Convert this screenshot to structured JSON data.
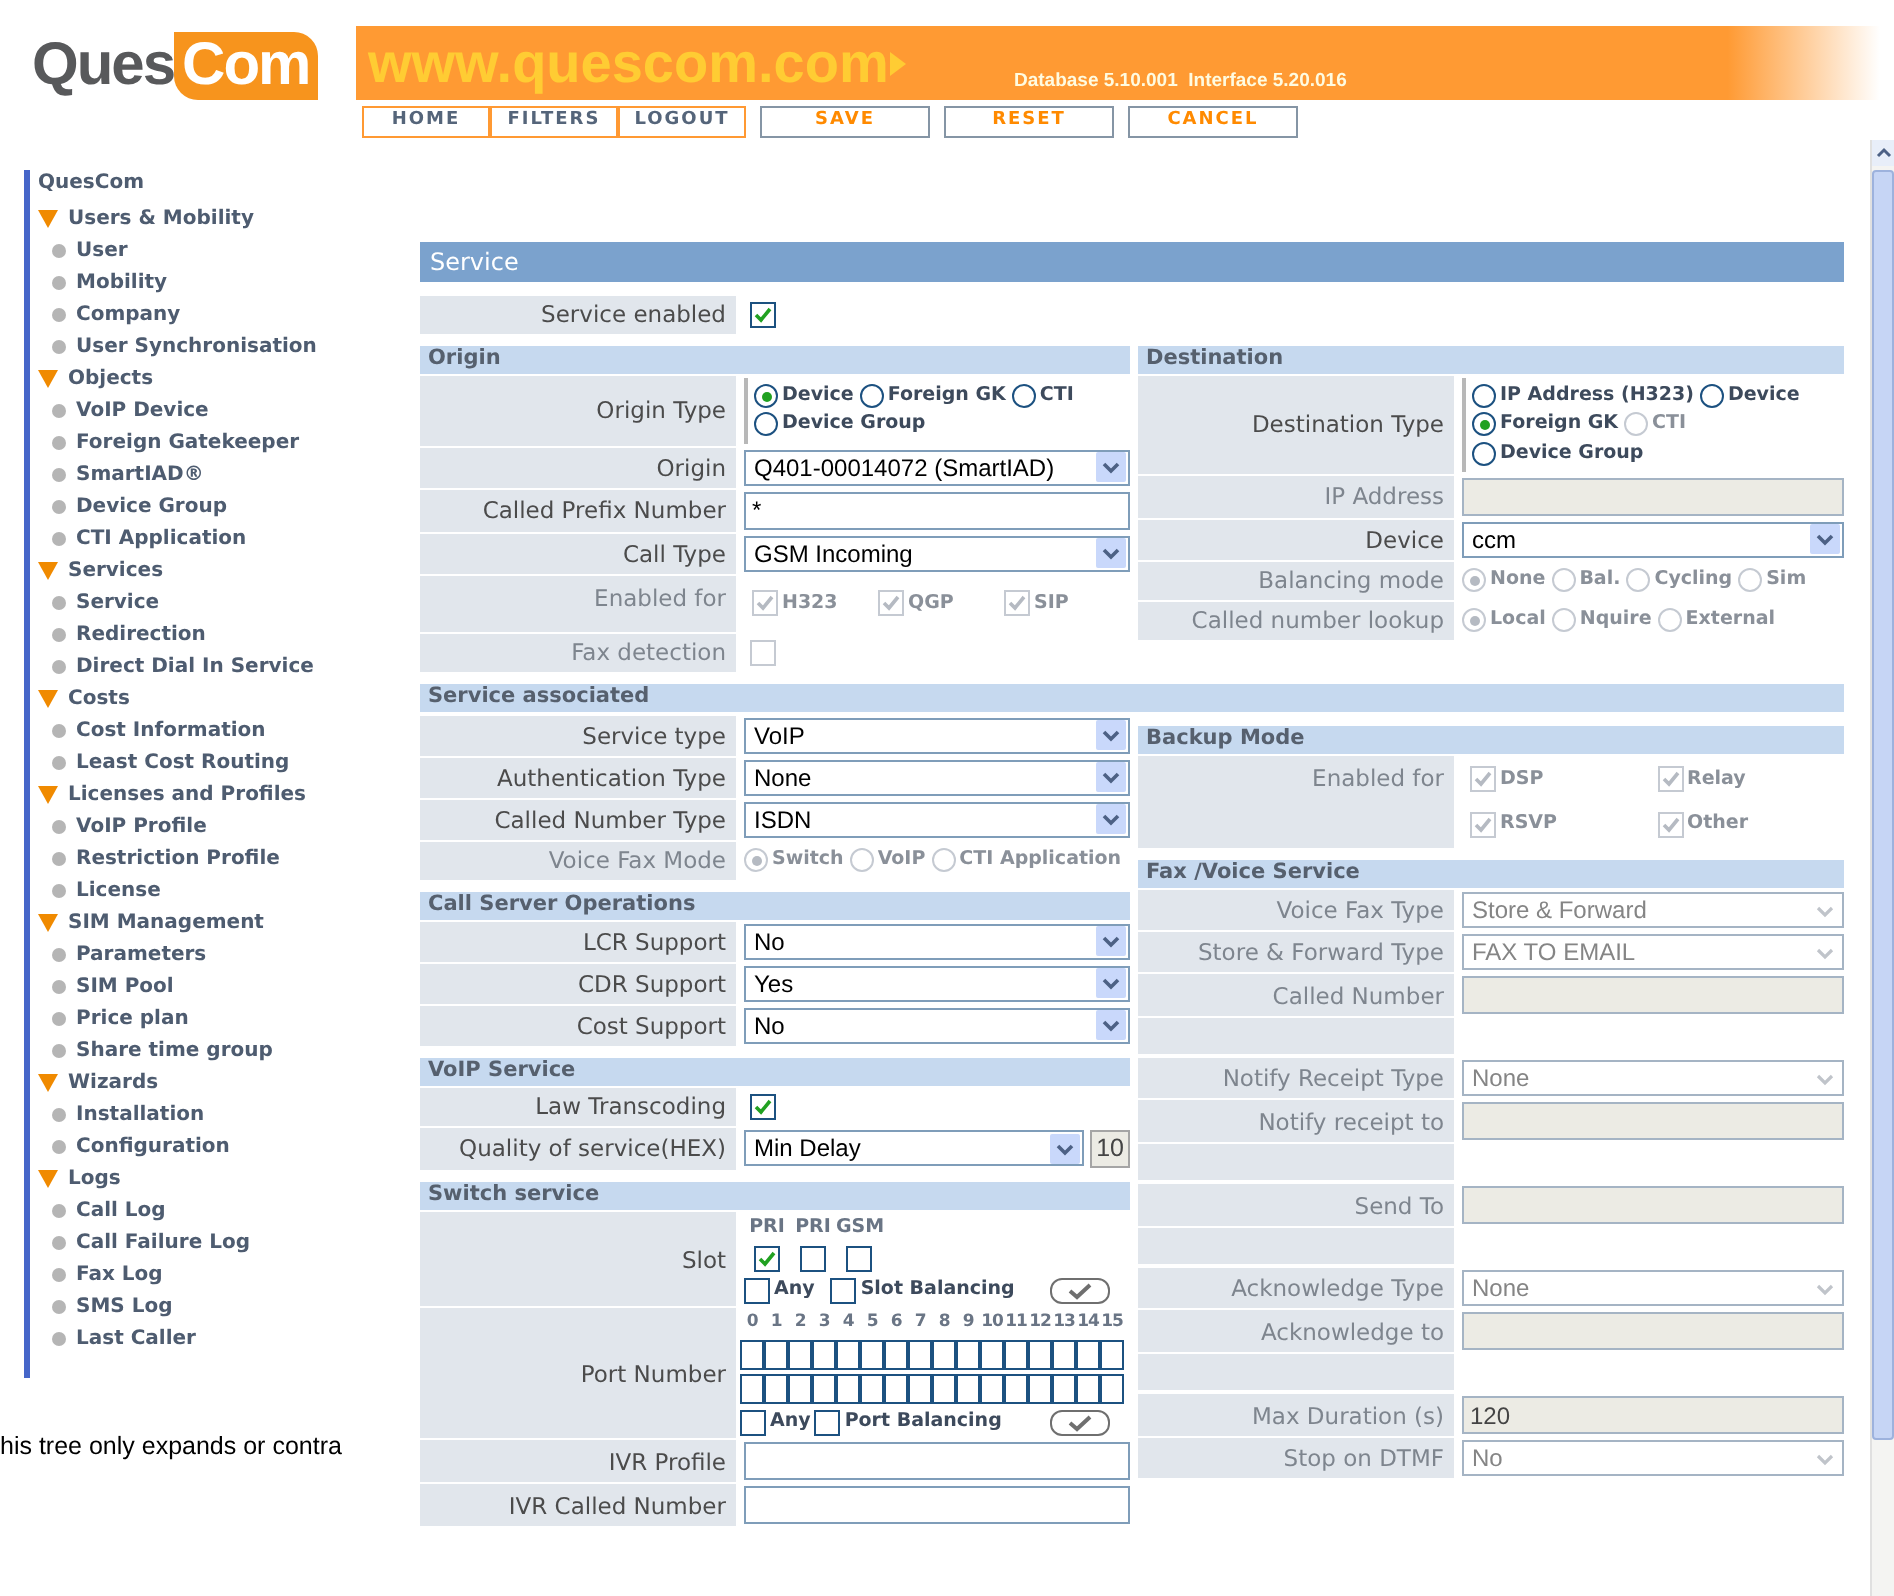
{
  "header": {
    "logo": {
      "part_1": "Ques",
      "part_2": "Com"
    },
    "banner": {
      "url": "www.quescom.com",
      "version": "Database 5.10.001  Interface 5.20.016"
    },
    "nav": [
      {
        "label": "HOME",
        "kind": "nav"
      },
      {
        "label": "FILTERS",
        "kind": "nav"
      },
      {
        "label": "LOGOUT",
        "kind": "nav"
      },
      {
        "label": "SAVE",
        "kind": "action"
      },
      {
        "label": "RESET",
        "kind": "action"
      },
      {
        "label": "CANCEL",
        "kind": "action"
      }
    ]
  },
  "sidebar": {
    "root": "QuesCom",
    "groups": [
      {
        "label": "Users & Mobility",
        "expanded": true,
        "children": [
          "User",
          "Mobility",
          "Company",
          "User Synchronisation"
        ]
      },
      {
        "label": "Objects",
        "expanded": true,
        "children": [
          "VoIP Device",
          "Foreign Gatekeeper",
          "SmartIAD®",
          "Device Group",
          "CTI Application"
        ]
      },
      {
        "label": "Services",
        "expanded": true,
        "children": [
          "Service",
          "Redirection",
          "Direct Dial In Service"
        ]
      },
      {
        "label": "Costs",
        "expanded": true,
        "children": [
          "Cost Information",
          "Least Cost Routing"
        ]
      },
      {
        "label": "Licenses and Profiles",
        "expanded": true,
        "children": [
          "VoIP Profile",
          "Restriction Profile",
          "License"
        ]
      },
      {
        "label": "SIM Management",
        "expanded": true,
        "children": [
          "Parameters",
          "SIM Pool",
          "Price plan",
          "Share time group"
        ]
      },
      {
        "label": "Wizards",
        "expanded": true,
        "children": [
          "Installation",
          "Configuration"
        ]
      },
      {
        "label": "Logs",
        "expanded": true,
        "children": [
          "Call Log",
          "Call Failure Log",
          "Fax Log",
          "SMS Log",
          "Last Caller"
        ]
      }
    ],
    "footnote": "his tree only expands or contra"
  },
  "form": {
    "title": "Service",
    "enabled": {
      "label": "Service enabled",
      "checked": true
    },
    "blocks": [
      {
        "left": [
          {
            "title": "Origin",
            "rows": [
              {
                "kind": "radios",
                "label": "Origin Type",
                "disabled": false,
                "options": [
                  {
                    "label": "Device",
                    "selected": true,
                    "disabled": false
                  },
                  {
                    "label": "Foreign GK",
                    "selected": false,
                    "disabled": false
                  },
                  {
                    "label": "CTI",
                    "selected": false,
                    "disabled": false
                  },
                  {
                    "label": "Device Group",
                    "selected": false,
                    "disabled": false
                  }
                ]
              },
              {
                "kind": "select",
                "label": "Origin",
                "disabled": false,
                "value": "Q401-00014072 (SmartIAD)"
              },
              {
                "kind": "input",
                "label": "Called Prefix Number",
                "disabled": false,
                "value": "*"
              },
              {
                "kind": "select",
                "label": "Call Type",
                "disabled": false,
                "value": "GSM Incoming"
              },
              {
                "kind": "checks",
                "label": "Enabled for",
                "disabled": true,
                "options": [
                  {
                    "label": "H323",
                    "checked": true
                  },
                  {
                    "label": "QGP",
                    "checked": true
                  },
                  {
                    "label": "SIP",
                    "checked": true
                  }
                ]
              },
              {
                "kind": "check",
                "label": "Fax detection",
                "disabled": true,
                "checked": false
              }
            ]
          }
        ],
        "right": [
          {
            "title": "Destination",
            "rows": [
              {
                "kind": "radios",
                "label": "Destination Type",
                "disabled": false,
                "options": [
                  {
                    "label": "IP Address (H323)",
                    "selected": false,
                    "disabled": false
                  },
                  {
                    "label": "Device",
                    "selected": false,
                    "disabled": false
                  },
                  {
                    "label": "Foreign GK",
                    "selected": true,
                    "disabled": false
                  },
                  {
                    "label": "CTI",
                    "selected": false,
                    "disabled": true
                  },
                  {
                    "label": "Device Group",
                    "selected": false,
                    "disabled": false
                  }
                ]
              },
              {
                "kind": "input",
                "label": "IP Address",
                "disabled": true
              },
              {
                "kind": "select",
                "label": "Device",
                "disabled": false,
                "value": "ccm"
              },
              {
                "kind": "radios",
                "label": "Balancing mode",
                "disabled": true,
                "options": [
                  {
                    "label": "None",
                    "selected": true
                  },
                  {
                    "label": "Bal.",
                    "selected": false
                  },
                  {
                    "label": "Cycling",
                    "selected": false
                  },
                  {
                    "label": "Sim",
                    "selected": false
                  }
                ]
              },
              {
                "kind": "radios",
                "label": "Called number lookup",
                "disabled": true,
                "options": [
                  {
                    "label": "Local",
                    "selected": true
                  },
                  {
                    "label": "Nquire",
                    "selected": false
                  },
                  {
                    "label": "External",
                    "selected": false
                  }
                ]
              }
            ]
          }
        ]
      },
      {
        "title": "Service associated",
        "left": [
          {
            "rows": [
              {
                "kind": "select",
                "label": "Service type",
                "disabled": false,
                "value": "VoIP"
              },
              {
                "kind": "select",
                "label": "Authentication Type",
                "disabled": false,
                "value": "None"
              },
              {
                "kind": "select",
                "label": "Called Number Type",
                "disabled": false,
                "value": "ISDN"
              },
              {
                "kind": "radios",
                "label": "Voice Fax Mode",
                "disabled": true,
                "options": [
                  {
                    "label": "Switch",
                    "selected": true
                  },
                  {
                    "label": "VoIP",
                    "selected": false
                  },
                  {
                    "label": "CTI Application",
                    "selected": false
                  }
                ]
              }
            ]
          },
          {
            "title": "Call Server Operations",
            "rows": [
              {
                "kind": "select",
                "label": "LCR Support",
                "disabled": false,
                "value": "No"
              },
              {
                "kind": "select",
                "label": "CDR Support",
                "disabled": false,
                "value": "Yes"
              },
              {
                "kind": "select",
                "label": "Cost Support",
                "disabled": false,
                "value": "No"
              }
            ]
          },
          {
            "title": "VoIP Service",
            "rows": [
              {
                "kind": "check",
                "label": "Law Transcoding",
                "disabled": false,
                "checked": true
              },
              {
                "kind": "select_badge",
                "label": "Quality of service(HEX)",
                "disabled": false,
                "value": "Min Delay",
                "badge": "10"
              }
            ]
          },
          {
            "title": "Switch service",
            "rows": [
              {
                "kind": "slots",
                "label": "Slot",
                "disabled": false,
                "headers": [
                  "PRI",
                  "PRI",
                  "GSM"
                ],
                "slots": [
                  {
                    "checked": true
                  },
                  {
                    "checked": false
                  },
                  {
                    "checked": false
                  }
                ],
                "options": [
                  {
                    "label": "Any",
                    "checked": false
                  },
                  {
                    "label": "Slot Balancing",
                    "checked": false
                  }
                ]
              },
              {
                "kind": "ports",
                "label": "Port Number",
                "disabled": false,
                "numbers": [
                  "0",
                  "1",
                  "2",
                  "3",
                  "4",
                  "5",
                  "6",
                  "7",
                  "8",
                  "9",
                  "10",
                  "11",
                  "12",
                  "13",
                  "14",
                  "15"
                ],
                "port_rows": [
                  [
                    {
                      "checked": false
                    },
                    {
                      "checked": false
                    },
                    {
                      "checked": false
                    },
                    {
                      "checked": false
                    },
                    {
                      "checked": false
                    },
                    {
                      "checked": false
                    },
                    {
                      "checked": false
                    },
                    {
                      "checked": false
                    },
                    {
                      "checked": false
                    },
                    {
                      "checked": false
                    },
                    {
                      "checked": false
                    },
                    {
                      "checked": false
                    },
                    {
                      "checked": false
                    },
                    {
                      "checked": false
                    },
                    {
                      "checked": false
                    },
                    {
                      "checked": false
                    }
                  ],
                  [
                    {
                      "checked": false
                    },
                    {
                      "checked": false
                    },
                    {
                      "checked": false
                    },
                    {
                      "checked": false
                    },
                    {
                      "checked": false
                    },
                    {
                      "checked": false
                    },
                    {
                      "checked": false
                    },
                    {
                      "checked": false
                    },
                    {
                      "checked": false
                    },
                    {
                      "checked": false
                    },
                    {
                      "checked": false
                    },
                    {
                      "checked": false
                    },
                    {
                      "checked": false
                    },
                    {
                      "checked": false
                    },
                    {
                      "checked": false
                    },
                    {
                      "checked": false
                    }
                  ]
                ],
                "options": [
                  {
                    "label": "Any",
                    "checked": false
                  },
                  {
                    "label": "Port Balancing",
                    "checked": false
                  }
                ]
              },
              {
                "kind": "input",
                "label": "IVR Profile",
                "disabled": false
              },
              {
                "kind": "input",
                "label": "IVR Called Number",
                "disabled": false
              }
            ]
          }
        ],
        "right": [
          {
            "title": "Backup Mode",
            "rows": [
              {
                "kind": "checks",
                "label": "Enabled for",
                "disabled": true,
                "options": [
                  {
                    "label": "DSP",
                    "checked": true
                  },
                  {
                    "label": "Relay",
                    "checked": true
                  },
                  {
                    "label": "RSVP",
                    "checked": true
                  },
                  {
                    "label": "Other",
                    "checked": true
                  }
                ]
              }
            ]
          },
          {
            "title": "Fax /Voice Service",
            "rows": [
              {
                "kind": "select",
                "label": "Voice Fax Type",
                "disabled": true,
                "value": "Store & Forward"
              },
              {
                "kind": "select",
                "label": "Store & Forward Type",
                "disabled": true,
                "value": "FAX TO EMAIL"
              },
              {
                "kind": "input",
                "label": "Called Number",
                "disabled": true
              },
              {
                "kind": "blank"
              },
              {
                "kind": "select",
                "label": "Notify Receipt Type",
                "disabled": true,
                "value": "None"
              },
              {
                "kind": "input",
                "label": "Notify receipt to",
                "disabled": true
              },
              {
                "kind": "blank"
              },
              {
                "kind": "input",
                "label": "Send To",
                "disabled": true
              },
              {
                "kind": "blank"
              },
              {
                "kind": "select",
                "label": "Acknowledge Type",
                "disabled": true,
                "value": "None"
              },
              {
                "kind": "input",
                "label": "Acknowledge to",
                "disabled": true
              },
              {
                "kind": "blank"
              },
              {
                "kind": "input",
                "label": "Max Duration (s)",
                "disabled": true,
                "value": "120"
              },
              {
                "kind": "select",
                "label": "Stop on DTMF",
                "disabled": true,
                "value": "No"
              }
            ]
          }
        ]
      }
    ]
  }
}
